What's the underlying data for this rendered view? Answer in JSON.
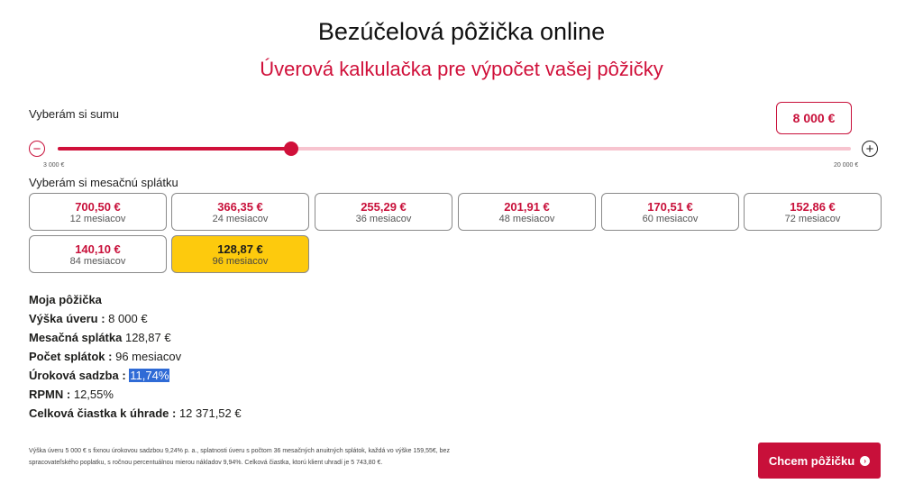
{
  "header": {
    "title": "Bezúčelová pôžička online",
    "subtitle": "Úverová kalkulačka pre výpočet vašej pôžičky"
  },
  "sum": {
    "label": "Vyberám si sumu",
    "value": "8 000 €",
    "min_label": "3 000 €",
    "max_label": "20 000 €",
    "min": 3000,
    "max": 20000,
    "current": 8000
  },
  "colors": {
    "accent": "#c8103a",
    "selected": "#fdca0d",
    "track": "#f7c4cf"
  },
  "icons": {
    "minus": "minus-circle-icon",
    "plus": "plus-circle-icon",
    "cta": "chevron-right-circle-icon"
  },
  "monthly": {
    "label": "Vyberám si mesačnú splátku",
    "options": [
      {
        "amount": "700,50 €",
        "months": "12 mesiacov"
      },
      {
        "amount": "366,35 €",
        "months": "24 mesiacov"
      },
      {
        "amount": "255,29 €",
        "months": "36 mesiacov"
      },
      {
        "amount": "201,91 €",
        "months": "48 mesiacov"
      },
      {
        "amount": "170,51 €",
        "months": "60 mesiacov"
      },
      {
        "amount": "152,86 €",
        "months": "72 mesiacov"
      },
      {
        "amount": "140,10 €",
        "months": "84 mesiacov"
      },
      {
        "amount": "128,87 €",
        "months": "96 mesiacov"
      }
    ],
    "selected_index": 7
  },
  "summary": {
    "heading": "Moja pôžička",
    "loan_label": "Výška úveru :",
    "loan_value": "8 000 €",
    "payment_label": "Mesačná splátka",
    "payment_value": "128,87 €",
    "count_label": "Počet splátok :",
    "count_value": "96 mesiacov",
    "rate_label": "Úroková sadzba :",
    "rate_value": "11,74%",
    "rpmn_label": "RPMN :",
    "rpmn_value": "12,55%",
    "total_label": "Celková čiastka k úhrade :",
    "total_value": "12 371,52 €"
  },
  "footnote": {
    "line1": "Výška úveru 5 000 € s fixnou úrokovou sadzbou 9,24% p. a., splatnosti úveru s počtom 36 mesačných anuitných splátok, každá vo výške 159,55€, bez",
    "line2": "spracovateľského poplatku, s ročnou percentuálnou mierou nákladov 9,94%. Celková čiastka, ktorú klient uhradí je 5 743,80 €."
  },
  "cta": {
    "label": "Chcem pôžičku"
  }
}
